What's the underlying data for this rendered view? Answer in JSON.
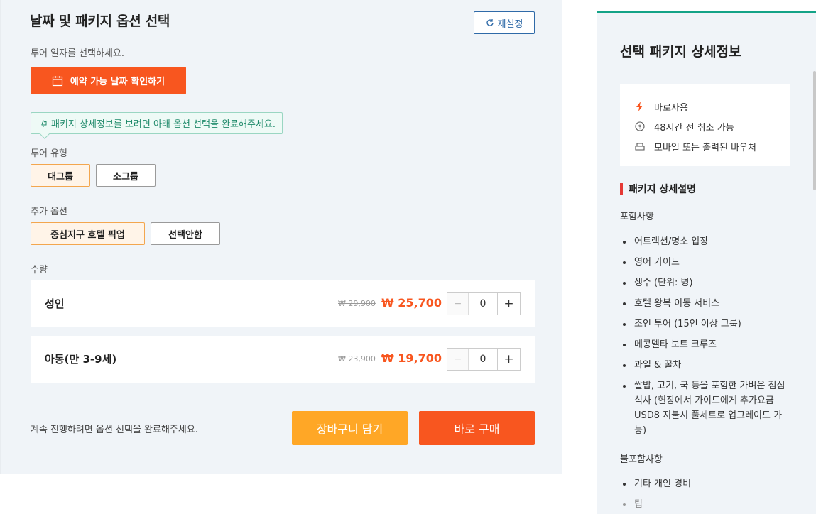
{
  "options": {
    "title": "날짜 및 패키지 옵션 선택",
    "reset_label": "재설정",
    "subtitle": "투어 일자를 선택하세요.",
    "date_button_label": "예약 가능 날짜 확인하기",
    "tip": "패키지 상세정보를 보려면 아래 옵션 선택을 완료해주세요.",
    "tour_type": {
      "label": "투어 유형",
      "choices": [
        "대그룹",
        "소그룹"
      ],
      "selected": "대그룹"
    },
    "extra": {
      "label": "추가 옵션",
      "choices": [
        "중심지구 호텔 픽업",
        "선택안함"
      ],
      "selected": "중심지구 호텔 픽업"
    },
    "quantity": {
      "label": "수량",
      "rows": [
        {
          "name": "성인",
          "old_price": "₩ 29,900",
          "new_price": "₩ 25,700",
          "qty": "0"
        },
        {
          "name": "아동(만 3-9세)",
          "old_price": "₩ 23,900",
          "new_price": "₩ 19,700",
          "qty": "0"
        }
      ],
      "minus": "−",
      "plus": "+"
    },
    "continue_text": "계속 진행하려면 옵션 선택을 완료해주세요.",
    "cart_label": "장바구니 담기",
    "buy_label": "바로 구매"
  },
  "detail": {
    "title": "선택 패키지 상세정보",
    "features": [
      {
        "icon": "lightning-icon",
        "label": "바로사용"
      },
      {
        "icon": "refund-icon",
        "label": "48시간 전 취소 가능"
      },
      {
        "icon": "ticket-icon",
        "label": "모바일 또는 출력된 바우처"
      }
    ],
    "section_title": "패키지 상세설명",
    "included_label": "포함사항",
    "included": [
      "어트랙션/명소 입장",
      "영어 가이드",
      "생수 (단위: 병)",
      "호텔 왕복 이동 서비스",
      "조인 투어 (15인 이상 그룹)",
      "메콩델타 보트 크루즈",
      "과일 & 꿀차",
      "쌀밥, 고기, 국 등을 포함한 가벼운 점심 식사 (현장에서 가이드에게 추가요금 USD8 지불시 풀세트로 업그레이드 가능)"
    ],
    "excluded_label": "불포함사항",
    "excluded": [
      "기타 개인 경비",
      "팁"
    ]
  },
  "colors": {
    "accent": "#f8561f",
    "cart": "#ffa726",
    "teal": "#14a387",
    "link": "#2f6aa8"
  }
}
